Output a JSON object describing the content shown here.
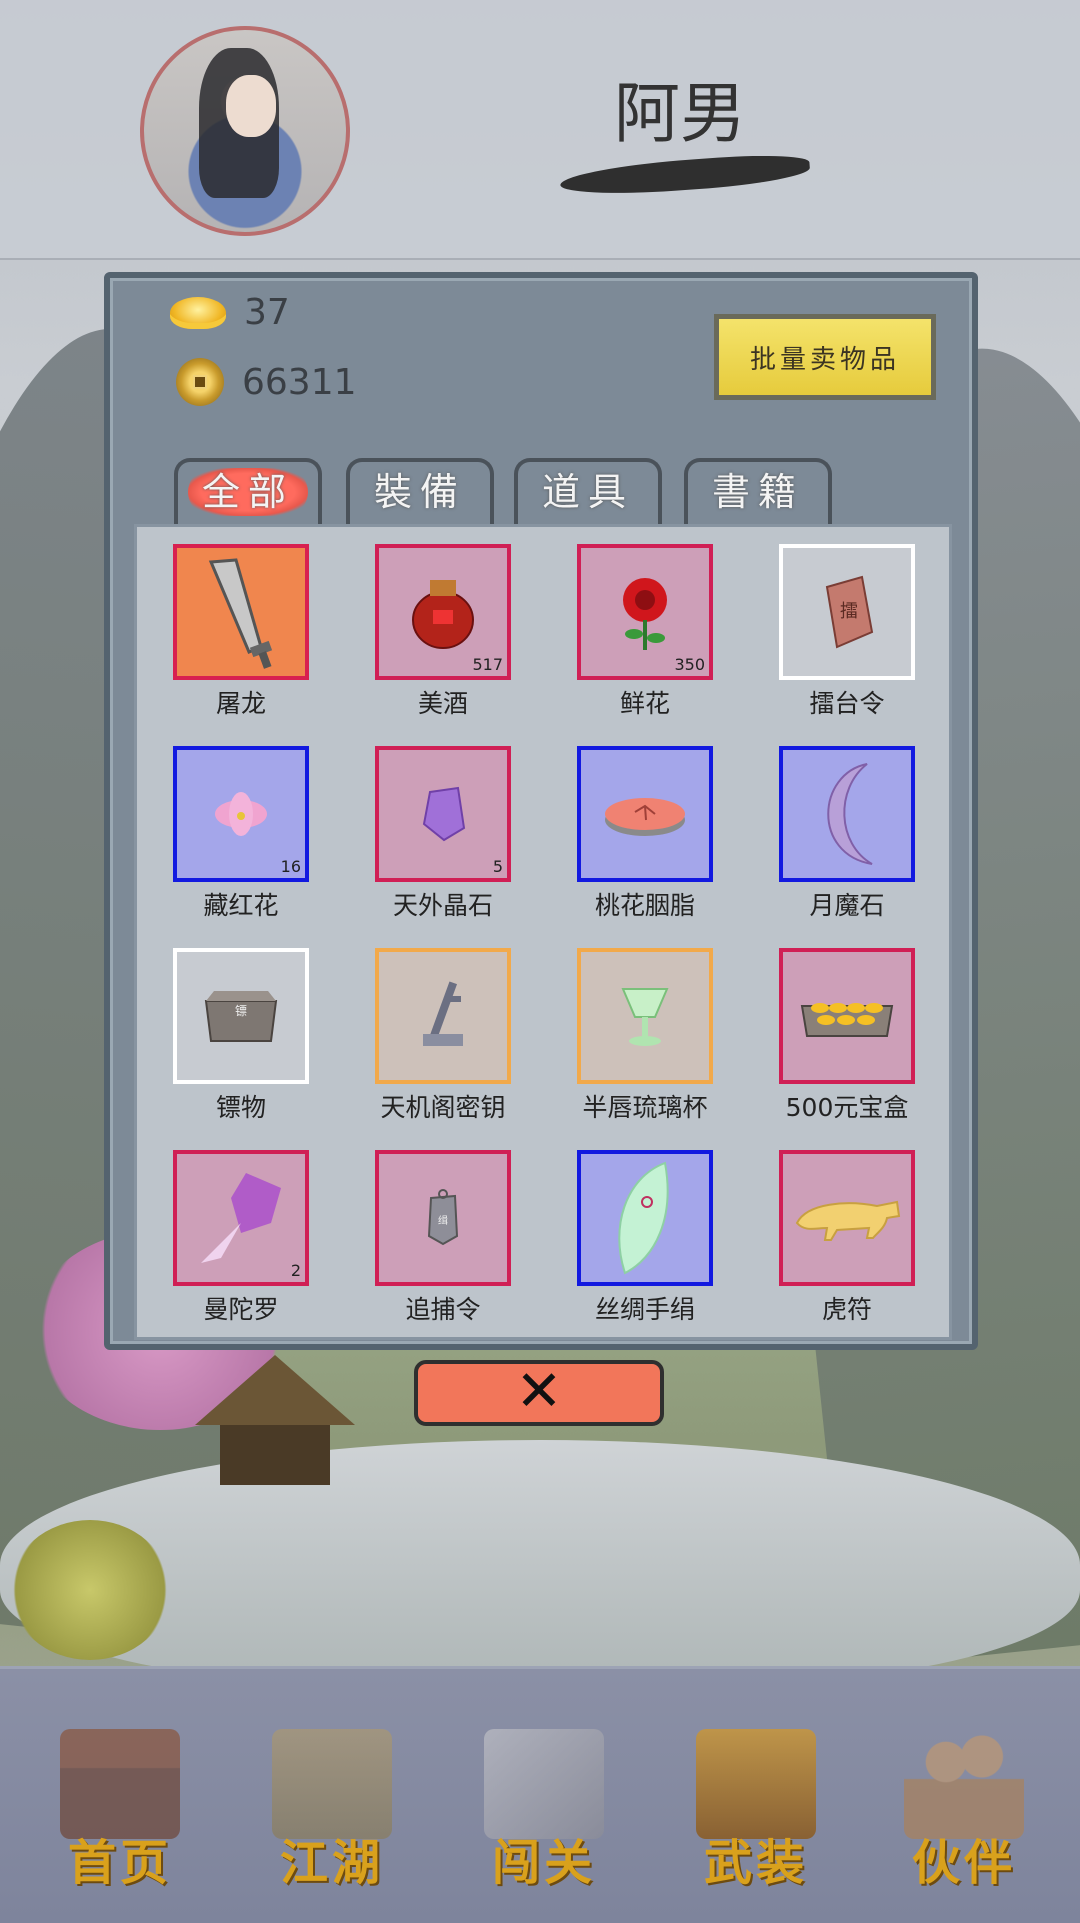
{
  "header": {
    "player_name": "阿男"
  },
  "currency": {
    "gold_ingot": "37",
    "copper_coin": "66311"
  },
  "bulk_sell_label": "批量卖物品",
  "tabs": [
    {
      "label": "全部",
      "active": true
    },
    {
      "label": "裝備",
      "active": false
    },
    {
      "label": "道具",
      "active": false
    },
    {
      "label": "書籍",
      "active": false
    }
  ],
  "items": [
    {
      "name": "屠龙",
      "qty": "",
      "rarity": "red",
      "icon": "sword-icon"
    },
    {
      "name": "美酒",
      "qty": "517",
      "rarity": "red",
      "icon": "wine-jar-icon"
    },
    {
      "name": "鲜花",
      "qty": "350",
      "rarity": "red",
      "icon": "rose-icon"
    },
    {
      "name": "擂台令",
      "qty": "",
      "rarity": "white",
      "icon": "token-icon"
    },
    {
      "name": "藏红花",
      "qty": "16",
      "rarity": "blue",
      "icon": "saffron-icon"
    },
    {
      "name": "天外晶石",
      "qty": "5",
      "rarity": "red",
      "icon": "crystal-icon"
    },
    {
      "name": "桃花胭脂",
      "qty": "",
      "rarity": "blue",
      "icon": "rouge-icon"
    },
    {
      "name": "月魔石",
      "qty": "",
      "rarity": "blue",
      "icon": "moon-stone-icon"
    },
    {
      "name": "镖物",
      "qty": "",
      "rarity": "white",
      "icon": "escort-box-icon"
    },
    {
      "name": "天机阁密钥",
      "qty": "",
      "rarity": "gold",
      "icon": "key-icon"
    },
    {
      "name": "半唇琉璃杯",
      "qty": "",
      "rarity": "gold",
      "icon": "glass-cup-icon"
    },
    {
      "name": "500元宝盒",
      "qty": "",
      "rarity": "red",
      "icon": "ingot-box-icon"
    },
    {
      "name": "曼陀罗",
      "qty": "2",
      "rarity": "red",
      "icon": "datura-icon"
    },
    {
      "name": "追捕令",
      "qty": "",
      "rarity": "red",
      "icon": "warrant-icon"
    },
    {
      "name": "丝绸手绢",
      "qty": "",
      "rarity": "blue",
      "icon": "handkerchief-icon"
    },
    {
      "name": "虎符",
      "qty": "",
      "rarity": "red",
      "icon": "tiger-tally-icon"
    }
  ],
  "close_label": "✕",
  "nav": [
    {
      "label": "首页",
      "icon": "home-icon"
    },
    {
      "label": "江湖",
      "icon": "scroll-icon"
    },
    {
      "label": "闯关",
      "icon": "crossed-swords-icon"
    },
    {
      "label": "武装",
      "icon": "armor-icon"
    },
    {
      "label": "伙伴",
      "icon": "partners-icon"
    }
  ],
  "colors": {
    "rarity_red": "#d01f55",
    "rarity_blue": "#1219e0",
    "rarity_white": "#ffffff",
    "rarity_gold": "#f2a94a",
    "nav_label": "#d9a11c",
    "close_button": "#f2765a"
  }
}
